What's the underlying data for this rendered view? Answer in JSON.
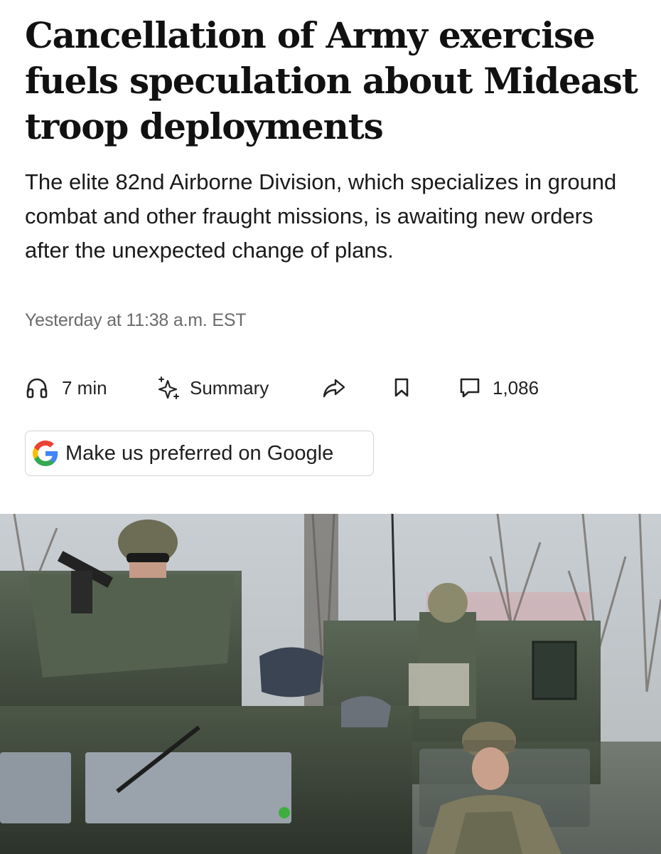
{
  "article": {
    "headline": "Cancellation of Army exercise fuels speculation about Mideast troop deployments",
    "dek": "The elite 82nd Airborne Division, which specializes in ground combat and other fraught missions, is awaiting new orders after the unexpected change of plans.",
    "timestamp": "Yesterday at 11:38 a.m. EST"
  },
  "actions": {
    "listen_label": "7 min",
    "summary_label": "Summary",
    "comments_count": "1,086"
  },
  "google_button": {
    "label": "Make us preferred on Google"
  },
  "icons": {
    "listen": "headphones-icon",
    "summary": "sparkle-icon",
    "share": "share-arrow-icon",
    "save": "bookmark-icon",
    "comments": "comment-bubble-icon",
    "google": "google-g-logo"
  },
  "colors": {
    "text": "#111111",
    "muted": "#6b6b6b",
    "border": "#d4d4d4"
  }
}
